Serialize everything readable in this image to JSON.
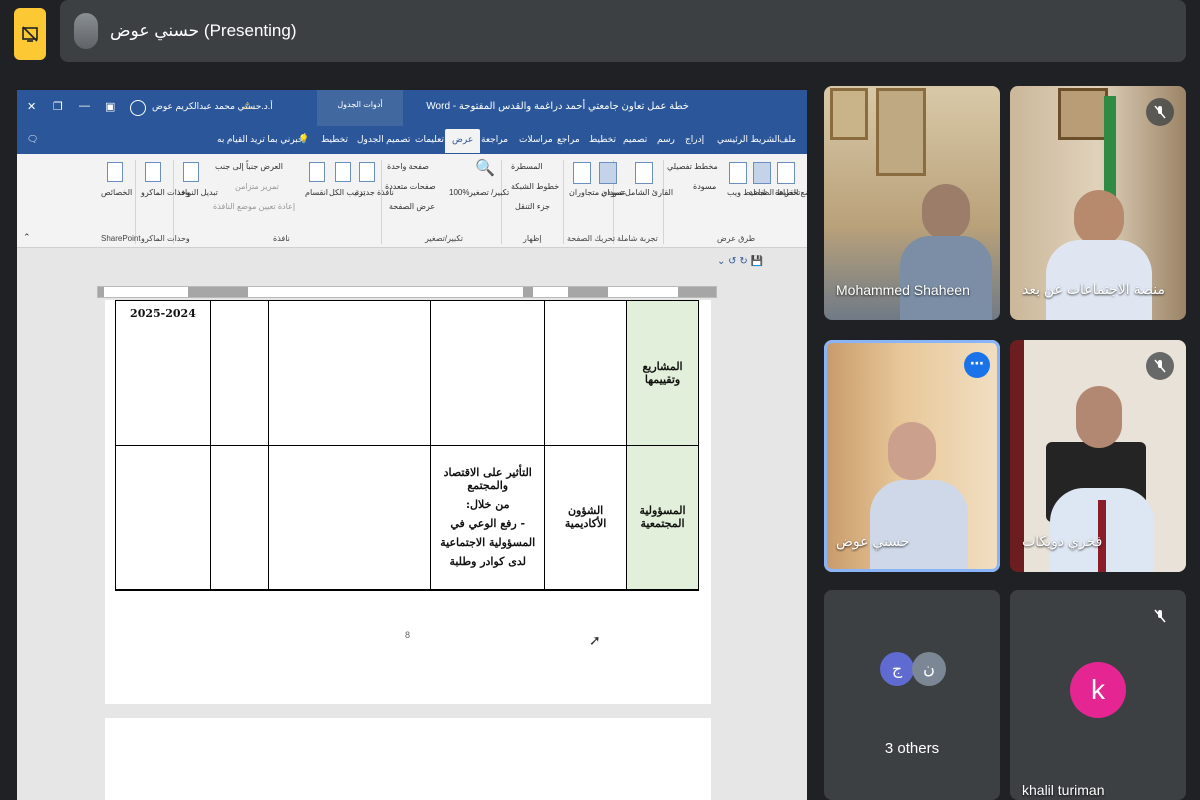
{
  "top_bar": {
    "present_icon": "present-off-icon",
    "presenter_label": "حسني عوض (Presenting)"
  },
  "word": {
    "doc_title": "خطة عمل تعاون جامعتي أحمد دراغمة والقدس المفتوحة - Word",
    "context_tab": "أدوات الجدول",
    "user_name": "أ.د.حسني محمد عبدالكريم عوض",
    "window_controls": [
      "minimize-icon",
      "restore-icon",
      "close-icon"
    ],
    "tabs": [
      "ملف",
      "الشريط الرئيسي",
      "إدراج",
      "رسم",
      "تصميم",
      "تخطيط",
      "مراجع",
      "مراسلات",
      "مراجعة",
      "عرض",
      "تعليمات",
      "تصميم الجدول",
      "تخطيط"
    ],
    "active_tab": "عرض",
    "tell_me": "أخبرني بما تريد القيام به",
    "ribbon": {
      "groups": [
        "طرق عرض",
        "تجربة شاملة",
        "تحريك الصفحة",
        "إظهار",
        "تكبير/تصغير",
        "نافذة",
        "وحدات الماكرو",
        "SharePoint"
      ],
      "views": [
        "وضع القراءة",
        "تخطيط الطباعة",
        "تخطيط ويب",
        "مخطط تفصيلي",
        "مسودة"
      ],
      "immersive": "القارئ الشامل",
      "page_move": [
        "عمودي",
        "عمودان متجاوران"
      ],
      "show": [
        "المسطرة",
        "خطوط الشبكة",
        "جزء التنقل"
      ],
      "zoom": [
        "تكبير/ تصغير",
        "100%",
        "صفحة واحدة",
        "صفحات متعددة",
        "عرض الصفحة"
      ],
      "window": [
        "نافذة جديدة",
        "ترتيب الكل",
        "انقسام",
        "العرض جنباً إلى جنب",
        "تمرير متزامن",
        "إعادة تعيين موضع النافذة",
        "تبديل النوافذ"
      ],
      "macros": "وحدات الماكرو",
      "properties": "الخصائص"
    },
    "table": {
      "row1": [
        "المشاريع وتقييمها",
        "",
        "",
        "",
        "",
        "2025-2024"
      ],
      "row2": {
        "axis": "المسؤولية المجتمعية",
        "responsible": "الشؤون الأكاديمية",
        "goal_lines": [
          "التأثير على الاقتصاد والمجتمع",
          "من خلال:",
          "-   رفع الوعي في",
          "المسؤولية الاجتماعية",
          "لدى كوادر وطلبة"
        ]
      }
    },
    "page_number": "8"
  },
  "participants": [
    {
      "name": "Mohammed Shaheen",
      "muted": false
    },
    {
      "name": "منصة الاجتماعات عن بعد",
      "muted": true
    },
    {
      "name": "حسني عوض",
      "muted": false,
      "speaking": true
    },
    {
      "name": "فخري دويكات",
      "muted": true
    },
    {
      "name": "3 others",
      "initials": [
        "ج",
        "ن"
      ]
    },
    {
      "name": "khalil turiman",
      "initial": "k",
      "muted": true
    }
  ],
  "colors": {
    "word_blue": "#2b579a",
    "present_yellow": "#fcc934",
    "meet_bg": "#202124",
    "table_green": "#e2efda",
    "k_avatar": "#e52592"
  }
}
